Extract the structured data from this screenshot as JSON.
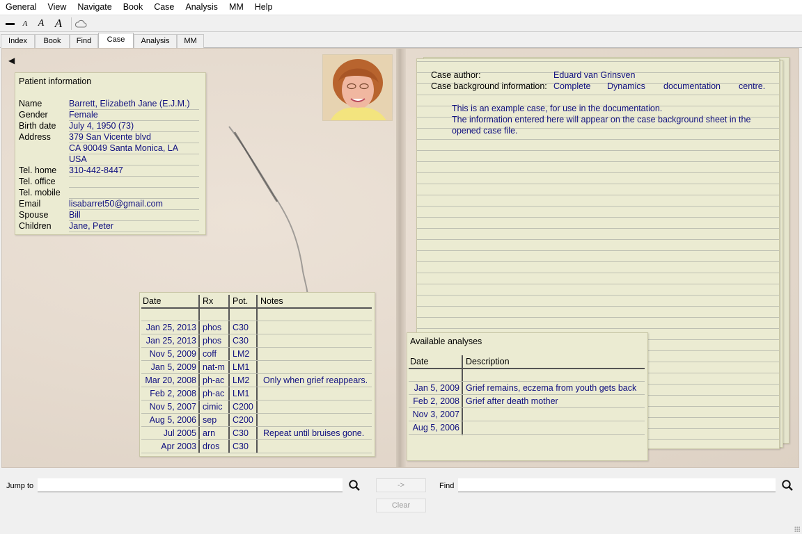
{
  "menu": [
    "General",
    "View",
    "Navigate",
    "Book",
    "Case",
    "Analysis",
    "MM",
    "Help"
  ],
  "toolbar": {
    "font_sizes": [
      "A",
      "A",
      "A"
    ]
  },
  "tabs": [
    "Index",
    "Book",
    "Find",
    "Case",
    "Analysis",
    "MM"
  ],
  "active_tab": "Case",
  "patient": {
    "title": "Patient information",
    "fields": [
      {
        "label": "Name",
        "value": "Barrett, Elizabeth Jane (E.J.M.)"
      },
      {
        "label": "Gender",
        "value": "Female"
      },
      {
        "label": "Birth date",
        "value": "July 4, 1950 (73)"
      },
      {
        "label": "Address",
        "value": "379 San Vicente blvd"
      },
      {
        "label": "",
        "value": "CA 90049  Santa Monica, LA"
      },
      {
        "label": "",
        "value": "USA"
      },
      {
        "label": "Tel. home",
        "value": "310-442-8447"
      },
      {
        "label": "Tel. office",
        "value": ""
      },
      {
        "label": "Tel. mobile",
        "value": ""
      },
      {
        "label": "Email",
        "value": "lisabarret50@gmail.com"
      },
      {
        "label": "Spouse",
        "value": "Bill"
      },
      {
        "label": "Children",
        "value": "Jane, Peter"
      }
    ]
  },
  "prescriptions": {
    "headers": [
      "Date",
      "Rx",
      "Pot.",
      "Notes"
    ],
    "rows": [
      [
        "Jan 25, 2013",
        "phos",
        "C30",
        ""
      ],
      [
        "Jan 25, 2013",
        "phos",
        "C30",
        ""
      ],
      [
        "Nov 5, 2009",
        "coff",
        "LM2",
        ""
      ],
      [
        "Jan 5, 2009",
        "nat-m",
        "LM1",
        ""
      ],
      [
        "Mar 20, 2008",
        "ph-ac",
        "LM2",
        "Only when grief reappears."
      ],
      [
        "Feb 2, 2008",
        "ph-ac",
        "LM1",
        ""
      ],
      [
        "Nov 5, 2007",
        "cimic",
        "C200",
        ""
      ],
      [
        "Aug 5, 2006",
        "sep",
        "C200",
        ""
      ],
      [
        "Jul 2005",
        "arn",
        "C30",
        "Repeat until bruises gone."
      ],
      [
        "Apr 2003",
        "dros",
        "C30",
        ""
      ]
    ]
  },
  "case_info": {
    "author_label": "Case author:",
    "author": "Eduard van Grinsven",
    "background_label": "Case background information:",
    "background_words": [
      "Complete",
      "Dynamics",
      "documentation",
      "centre."
    ],
    "notes": [
      "This is an example case, for use in the documentation.",
      "The information entered here will appear on the case background sheet in the",
      "opened case file."
    ]
  },
  "analyses": {
    "title": "Available analyses",
    "headers": [
      "Date",
      "Description"
    ],
    "rows": [
      [
        "Jan 5, 2009",
        "Grief remains, eczema from youth gets back"
      ],
      [
        "Feb 2, 2008",
        "Grief after death mother"
      ],
      [
        "Nov 3, 2007",
        ""
      ],
      [
        "Aug 5, 2006",
        ""
      ]
    ]
  },
  "bottom": {
    "jump_label": "Jump to",
    "go_label": "->",
    "find_label": "Find",
    "clear_label": "Clear"
  }
}
